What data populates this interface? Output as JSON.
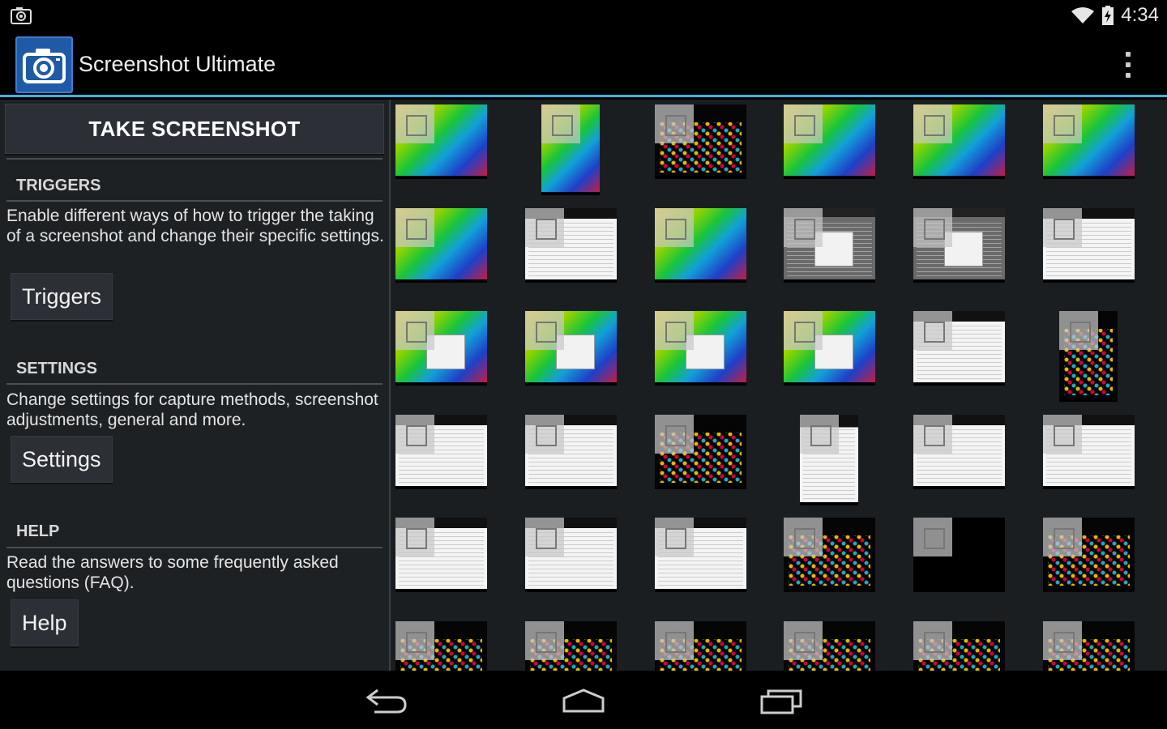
{
  "status_bar": {
    "time": "4:34",
    "icons": [
      "screenshot-icon",
      "wifi-icon",
      "battery-charging-icon"
    ]
  },
  "action_bar": {
    "title": "Screenshot Ultimate",
    "logo_icon": "camera-icon",
    "menu_icon": "overflow-menu-icon",
    "accent_color": "#33b5e5"
  },
  "left_pane": {
    "take_screenshot_label": "TAKE SCREENSHOT",
    "sections": [
      {
        "header": "TRIGGERS",
        "description": "Enable different ways of how to trigger the taking of a screenshot and change their specific settings.",
        "button_label": "Triggers"
      },
      {
        "header": "SETTINGS",
        "description": "Change settings for capture methods, screenshot adjustments, general and more.",
        "button_label": "Settings"
      },
      {
        "header": "HELP",
        "description": "Read the answers to some frequently asked questions (FAQ).",
        "button_label": "Help"
      }
    ]
  },
  "grid": {
    "columns": 6,
    "thumbnails": [
      {
        "kind": "nexus",
        "shape": "landscape"
      },
      {
        "kind": "nexus",
        "shape": "portrait"
      },
      {
        "kind": "apps",
        "shape": "landscape"
      },
      {
        "kind": "nexus",
        "shape": "landscape"
      },
      {
        "kind": "nexus",
        "shape": "landscape"
      },
      {
        "kind": "nexus",
        "shape": "landscape"
      },
      {
        "kind": "nexus",
        "shape": "landscape"
      },
      {
        "kind": "white",
        "shape": "landscape"
      },
      {
        "kind": "nexus",
        "shape": "landscape"
      },
      {
        "kind": "greywin",
        "shape": "landscape"
      },
      {
        "kind": "greywin",
        "shape": "landscape"
      },
      {
        "kind": "white",
        "shape": "landscape"
      },
      {
        "kind": "nexus-dialog",
        "shape": "landscape"
      },
      {
        "kind": "nexus-dialog",
        "shape": "landscape"
      },
      {
        "kind": "nexus-dialog",
        "shape": "landscape"
      },
      {
        "kind": "nexus-dialog",
        "shape": "landscape"
      },
      {
        "kind": "white",
        "shape": "landscape"
      },
      {
        "kind": "apps",
        "shape": "portrait"
      },
      {
        "kind": "white",
        "shape": "landscape"
      },
      {
        "kind": "white",
        "shape": "landscape"
      },
      {
        "kind": "apps",
        "shape": "landscape"
      },
      {
        "kind": "white",
        "shape": "portrait"
      },
      {
        "kind": "white",
        "shape": "landscape"
      },
      {
        "kind": "white",
        "shape": "landscape"
      },
      {
        "kind": "white",
        "shape": "landscape"
      },
      {
        "kind": "white",
        "shape": "landscape"
      },
      {
        "kind": "white",
        "shape": "landscape"
      },
      {
        "kind": "apps",
        "shape": "landscape"
      },
      {
        "kind": "black",
        "shape": "landscape"
      },
      {
        "kind": "apps",
        "shape": "landscape"
      },
      {
        "kind": "apps",
        "shape": "landscape"
      },
      {
        "kind": "apps",
        "shape": "landscape"
      },
      {
        "kind": "apps",
        "shape": "landscape"
      },
      {
        "kind": "apps",
        "shape": "landscape"
      },
      {
        "kind": "apps",
        "shape": "landscape"
      },
      {
        "kind": "apps",
        "shape": "landscape"
      }
    ]
  },
  "nav_bar": {
    "buttons": [
      "back-icon",
      "home-icon",
      "recents-icon"
    ]
  }
}
